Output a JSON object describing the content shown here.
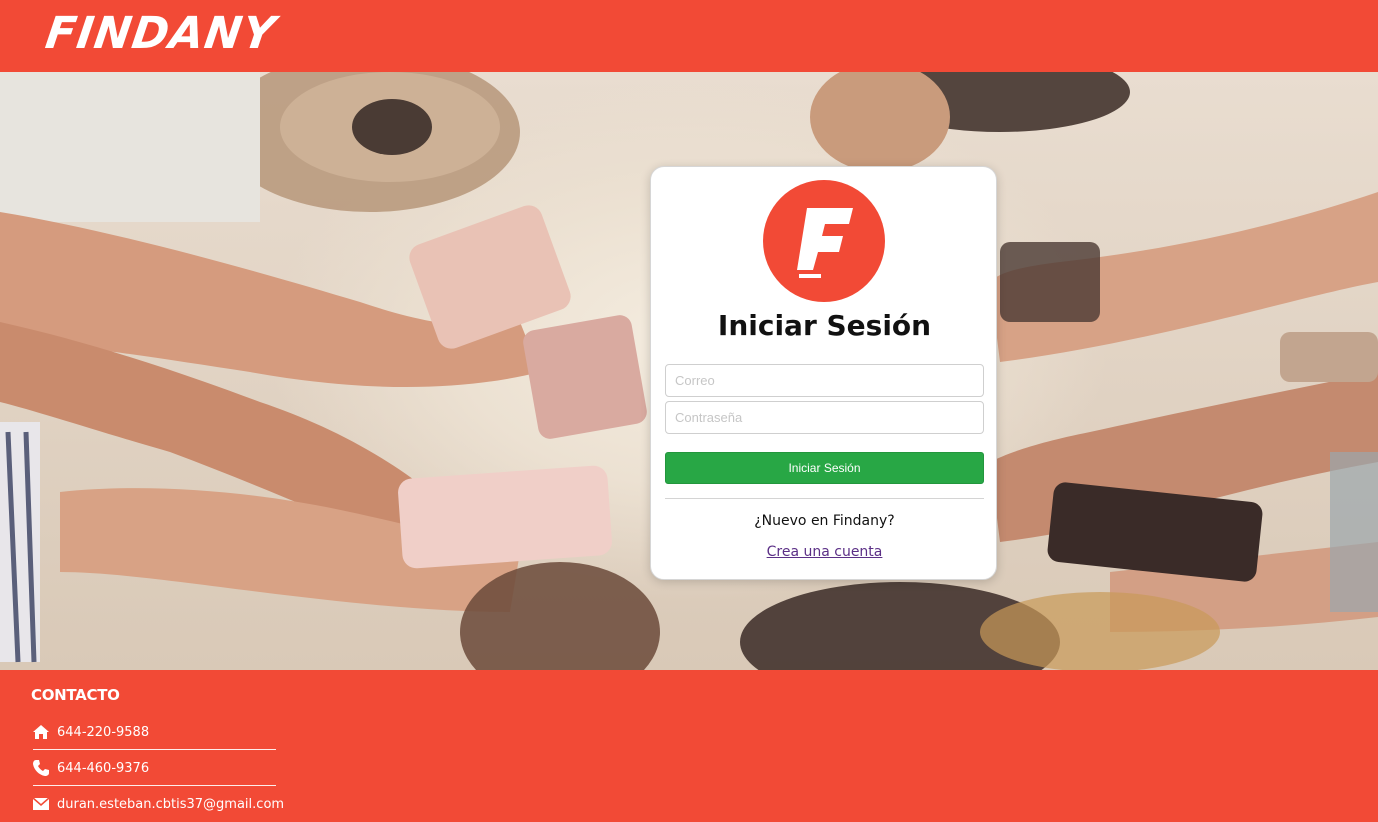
{
  "header": {
    "brand": "FINDANY"
  },
  "login": {
    "logo_letter": "F",
    "title": "Iniciar Sesión",
    "email_placeholder": "Correo",
    "password_placeholder": "Contraseña",
    "submit_label": "Iniciar Sesión",
    "new_user_text": "¿Nuevo en Findany?",
    "create_account_label": "Crea una cuenta"
  },
  "footer": {
    "title": "CONTACTO",
    "contacts": [
      {
        "icon": "home-icon",
        "text": "644-220-9588"
      },
      {
        "icon": "phone-icon",
        "text": "644-460-9376"
      },
      {
        "icon": "mail-icon",
        "text": "duran.esteban.cbtis37@gmail.com"
      }
    ]
  },
  "colors": {
    "brand_red": "#f24a36",
    "button_green": "#28a745",
    "link_purple": "#5b2f86"
  }
}
